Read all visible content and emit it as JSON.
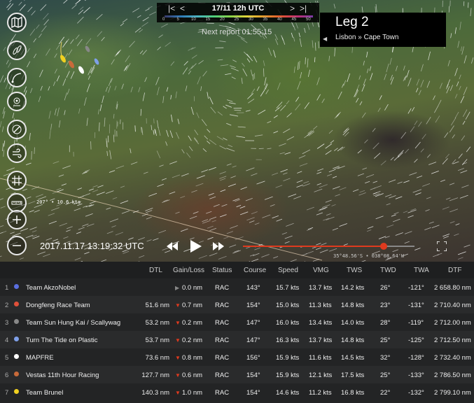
{
  "timebar": {
    "prev_first": "|<",
    "prev": "<",
    "datetime": "17/11 12h UTC",
    "next": ">",
    "next_last": ">|",
    "scale_labels": [
      "0",
      "5",
      "10",
      "15",
      "20",
      "25",
      "30",
      "35",
      "40",
      "45",
      "50"
    ]
  },
  "next_report": "Next report 01:55:15",
  "leg_panel": {
    "leg": "Leg 2",
    "route": "Lisbon » Cape Town",
    "arrow": "◀"
  },
  "wind_readout": "207° • 10.6 kts",
  "coord_readout": "35°48.56'S • 038°08.64'W",
  "current_datetime": "2017.11.17 13:19:32 UTC",
  "timeline": {
    "progress": 0.82
  },
  "sidebar_icons": [
    "map-icon",
    "boats-icon",
    "route-icon",
    "target-icon",
    "compass-icon",
    "wind-icon",
    "grid-icon",
    "ruler-icon",
    "zoom-in-icon",
    "zoom-out-icon"
  ],
  "table": {
    "headers": [
      "DTL",
      "Gain/Loss",
      "Status",
      "Course",
      "Speed",
      "VMG",
      "TWS",
      "TWD",
      "TWA",
      "DTF"
    ],
    "rows": [
      {
        "rank": "1",
        "team": "Team AkzoNobel",
        "color": "#5a6fe0",
        "dtl": "",
        "gain": "0.0 nm",
        "gain_type": "flat",
        "status": "RAC",
        "course": "143°",
        "speed": "15.7 kts",
        "vmg": "13.7 kts",
        "tws": "14.2 kts",
        "twd": "26°",
        "twa": "-121°",
        "dtf": "2 658.80 nm"
      },
      {
        "rank": "2",
        "team": "Dongfeng Race Team",
        "color": "#e0503a",
        "dtl": "51.6 nm",
        "gain": "0.7 nm",
        "gain_type": "down",
        "status": "RAC",
        "course": "154°",
        "speed": "15.0 kts",
        "vmg": "11.3 kts",
        "tws": "14.8 kts",
        "twd": "23°",
        "twa": "-131°",
        "dtf": "2 710.40 nm"
      },
      {
        "rank": "3",
        "team": "Team Sun Hung Kai / Scallywag",
        "color": "#888888",
        "dtl": "53.2 nm",
        "gain": "0.2 nm",
        "gain_type": "down",
        "status": "RAC",
        "course": "147°",
        "speed": "16.0 kts",
        "vmg": "13.4 kts",
        "tws": "14.0 kts",
        "twd": "28°",
        "twa": "-119°",
        "dtf": "2 712.00 nm"
      },
      {
        "rank": "4",
        "team": "Turn The Tide on Plastic",
        "color": "#7fa0e8",
        "dtl": "53.7 nm",
        "gain": "0.2 nm",
        "gain_type": "down",
        "status": "RAC",
        "course": "147°",
        "speed": "16.3 kts",
        "vmg": "13.7 kts",
        "tws": "14.8 kts",
        "twd": "25°",
        "twa": "-125°",
        "dtf": "2 712.50 nm"
      },
      {
        "rank": "5",
        "team": "MAPFRE",
        "color": "#ffffff",
        "dtl": "73.6 nm",
        "gain": "0.8 nm",
        "gain_type": "down",
        "status": "RAC",
        "course": "156°",
        "speed": "15.9 kts",
        "vmg": "11.6 kts",
        "tws": "14.5 kts",
        "twd": "32°",
        "twa": "-128°",
        "dtf": "2 732.40 nm"
      },
      {
        "rank": "6",
        "team": "Vestas 11th Hour Racing",
        "color": "#c86a3a",
        "dtl": "127.7 nm",
        "gain": "0.6 nm",
        "gain_type": "down",
        "status": "RAC",
        "course": "154°",
        "speed": "15.9 kts",
        "vmg": "12.1 kts",
        "tws": "17.5 kts",
        "twd": "25°",
        "twa": "-133°",
        "dtf": "2 786.50 nm"
      },
      {
        "rank": "7",
        "team": "Team Brunel",
        "color": "#f0d020",
        "dtl": "140.3 nm",
        "gain": "1.0 nm",
        "gain_type": "down",
        "status": "RAC",
        "course": "154°",
        "speed": "14.6 kts",
        "vmg": "11.2 kts",
        "tws": "16.8 kts",
        "twd": "22°",
        "twa": "-132°",
        "dtf": "2 799.10 nm"
      }
    ]
  }
}
